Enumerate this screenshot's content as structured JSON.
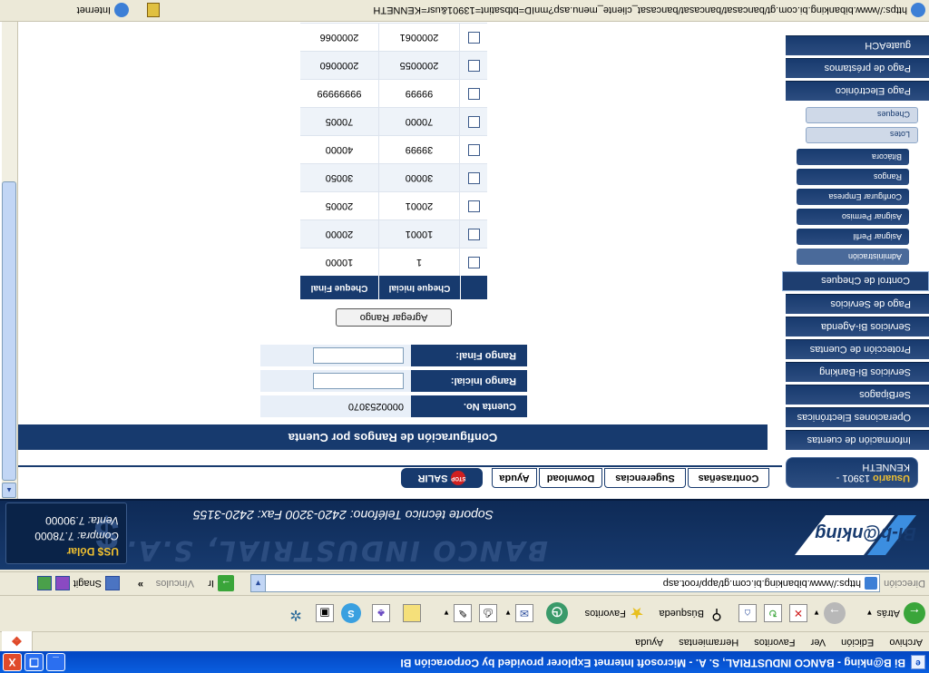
{
  "window": {
    "title": "Bi B@nking - BANCO INDUSTRIAL, S. A. - Microsoft Internet Explorer provided by Corporación BI",
    "controls": {
      "minimize": "_",
      "maximize": "❐",
      "close": "X"
    }
  },
  "menu": [
    "Archivo",
    "Edición",
    "Ver",
    "Favoritos",
    "Herramientas",
    "Ayuda"
  ],
  "toolbar": {
    "back": "Atrás",
    "search": "Búsqueda",
    "favorites": "Favoritos"
  },
  "address": {
    "label": "Dirección",
    "url": "https://www.bibanking.bi.com.gt/app/root.asp",
    "go": "Ir",
    "links": "Vínculos",
    "chevron": "»",
    "snagit": "Snagit"
  },
  "banner": {
    "logo": "Bi-b@nking",
    "bank_name": "BANCO INDUSTRIAL, S.A.",
    "support": "Soporte técnico  Teléfono: 2420-3200  Fax: 2420-3155",
    "usd_title": "US$ Dólar",
    "compra_label": "Compra:",
    "compra_value": "7.78000",
    "venta_label": "Venta:",
    "venta_value": "7.90000"
  },
  "user": {
    "label": "Usuario",
    "value": "13901 - KENNETH"
  },
  "nav": [
    {
      "label": "Información de cuentas"
    },
    {
      "label": "Operaciones Electrónicas"
    },
    {
      "label": "SerBipagos"
    },
    {
      "label": "Servicios Bi-Banking"
    },
    {
      "label": "Protección de Cuentas"
    },
    {
      "label": "Servicios Bi-Agenda"
    },
    {
      "label": "Pago de Servicios"
    },
    {
      "label": "Control de Cheques"
    },
    {
      "label": "Pago Electrónico"
    },
    {
      "label": "Pago de préstamos"
    },
    {
      "label": "guateACH"
    }
  ],
  "nav_sub": [
    "Administración",
    "Asignar Perfil",
    "Asignar Permiso",
    "Configurar Empresa",
    "Rangos",
    "Bitácora"
  ],
  "nav_sub2": [
    "Lotes",
    "Cheques"
  ],
  "tabs": [
    "Contraseñas",
    "Sugerencias",
    "Download",
    "Ayuda"
  ],
  "salir": {
    "label": "SALIR",
    "stop": "STOP"
  },
  "page": {
    "heading": "Configuración de Rangos por Cuenta",
    "cuenta_label": "Cuenta No.",
    "cuenta_value": "0000253070",
    "rango_inicial_label": "Rango Inicial:",
    "rango_final_label": "Rango Final:",
    "add_button": "Agregar Rango"
  },
  "table": {
    "headers": [
      "Cheque Inicial",
      "Cheque Final"
    ],
    "rows": [
      [
        "1",
        "10000"
      ],
      [
        "10001",
        "20000"
      ],
      [
        "20001",
        "20005"
      ],
      [
        "30000",
        "30050"
      ],
      [
        "39999",
        "40000"
      ],
      [
        "70000",
        "70005"
      ],
      [
        "99999",
        "99999999"
      ],
      [
        "2000055",
        "2000060"
      ],
      [
        "2000061",
        "2000066"
      ]
    ]
  },
  "status": {
    "url": "https://www.bibanking.bi.com.gt/bancasat/bancasat/bancasat_cliente_menu.asp?mnID=btbsatint=13901&usr=KENNETH",
    "zone": "Internet"
  }
}
